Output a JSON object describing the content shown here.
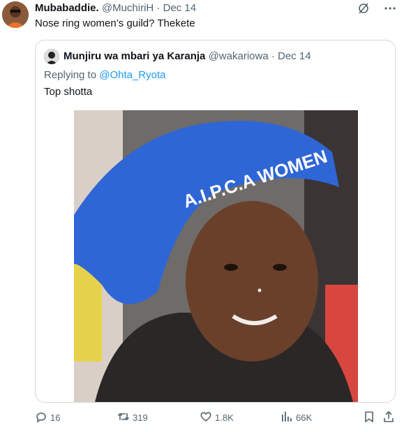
{
  "tweet": {
    "author_name": "Mubabaddie.",
    "handle": "@MuchiriH",
    "separator": "·",
    "date": "Dec 14",
    "text": "Nose ring women’s guild? Thekete"
  },
  "quote": {
    "author_name": "Munjiru wa mbari ya Karanja",
    "handle": "@wakariowa",
    "separator": "·",
    "date": "Dec 14",
    "reply_prefix": "Replying to",
    "reply_to": "@Ohta_Ryota",
    "text": "Top shotta",
    "headscarf_text": "A.I.P.C.A WOMEN"
  },
  "actions": {
    "replies": "16",
    "retweets": "319",
    "likes": "1.8K",
    "views": "66K"
  },
  "icons": {
    "grok": "slash-circle-icon",
    "more": "more-dots-icon",
    "reply": "reply-icon",
    "retweet": "retweet-icon",
    "like": "heart-icon",
    "views": "views-icon",
    "bookmark": "bookmark-icon",
    "share": "share-icon"
  },
  "colors": {
    "link": "#1d9bf0",
    "muted": "#536471",
    "border": "#cfd9de",
    "headscarf": "#2f66d6"
  }
}
